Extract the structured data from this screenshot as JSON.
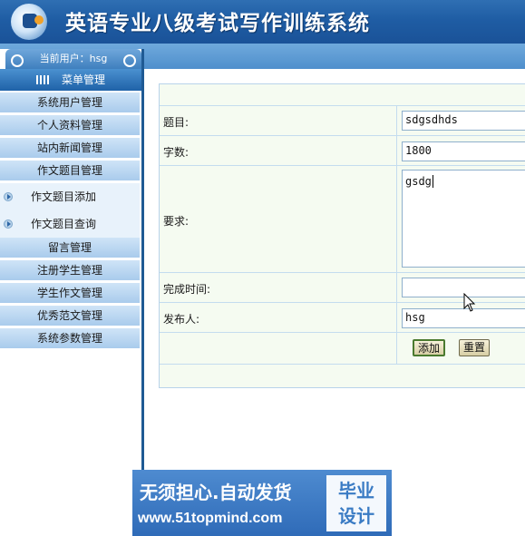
{
  "app": {
    "title": "英语专业八级考试写作训练系统"
  },
  "user": {
    "label": "当前用户：hsg"
  },
  "menu": {
    "header": "菜单管理",
    "items": [
      "系统用户管理",
      "个人资料管理",
      "站内新闻管理",
      "作文题目管理",
      "作文题目添加",
      "作文题目查询",
      "留言管理",
      "注册学生管理",
      "学生作文管理",
      "优秀范文管理",
      "系统参数管理"
    ]
  },
  "form": {
    "labels": {
      "title": "题目:",
      "words": "字数:",
      "requirement": "要求:",
      "deadline": "完成时间:",
      "publisher": "发布人:"
    },
    "values": {
      "title": "sdgsdhds",
      "words": "1800",
      "requirement": "gsdg",
      "deadline": "",
      "publisher": "hsg"
    },
    "buttons": {
      "add": "添加",
      "reset": "重置"
    }
  },
  "banner": {
    "line1": "无须担心.自动发货",
    "line2": "www.51topmind.com",
    "badge_line1": "毕业",
    "badge_line2": "设计"
  },
  "colors": {
    "header": "#1f5da4",
    "menu_item": "#b9d6f0",
    "form_bg": "#f5fbf1"
  }
}
